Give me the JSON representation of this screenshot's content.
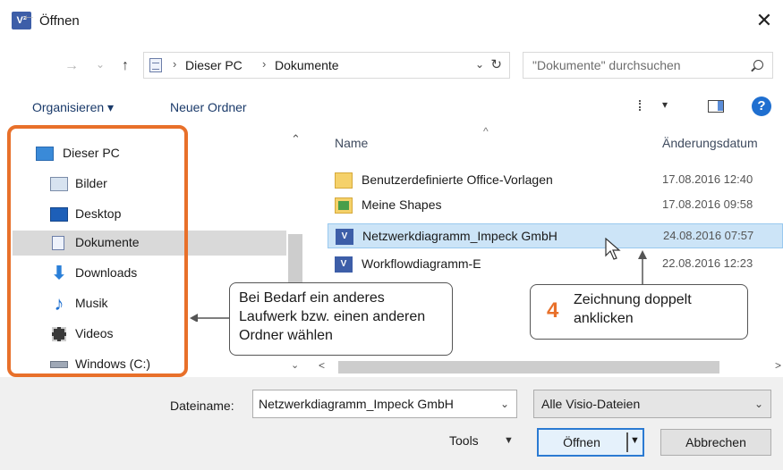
{
  "window": {
    "app_icon": "V²",
    "title": "Öffnen",
    "close": "✕"
  },
  "nav": {
    "back": "←",
    "forward": "→",
    "recent": "⌄",
    "up": "↑"
  },
  "address": {
    "crumbs": [
      "Dieser PC",
      "Dokumente"
    ],
    "separator": "›",
    "dropdown": "⌄",
    "refresh": "↻"
  },
  "search": {
    "placeholder": "\"Dokumente\" durchsuchen"
  },
  "toolbar": {
    "organize": "Organisieren ▾",
    "new_folder": "Neuer Ordner",
    "view_dropdown": "▾",
    "help": "?"
  },
  "sidebar": {
    "items": [
      {
        "label": "Dieser PC",
        "icon": "monitor-icon"
      },
      {
        "label": "Bilder",
        "icon": "pictures-icon"
      },
      {
        "label": "Desktop",
        "icon": "desktop-icon"
      },
      {
        "label": "Dokumente",
        "icon": "documents-icon"
      },
      {
        "label": "Downloads",
        "icon": "download-arrow-icon"
      },
      {
        "label": "Musik",
        "icon": "music-note-icon"
      },
      {
        "label": "Videos",
        "icon": "film-icon"
      },
      {
        "label": "Windows (C:)",
        "icon": "drive-icon"
      }
    ],
    "selected": "Dokumente"
  },
  "scrollbar": {
    "up": "⌃",
    "down": "⌄",
    "left": "<",
    "right": ">"
  },
  "filelist": {
    "headers": {
      "name": "Name",
      "date": "Änderungsdatum"
    },
    "sort_caret": "^",
    "rows": [
      {
        "name": "Benutzerdefinierte Office-Vorlagen",
        "date": "17.08.2016 12:40",
        "icon": "folder-icon"
      },
      {
        "name": "Meine Shapes",
        "date": "17.08.2016 09:58",
        "icon": "shapes-folder-icon"
      },
      {
        "name": "Netzwerkdiagramm_Impeck GmbH",
        "date": "24.08.2016 07:57",
        "icon": "visio-file-icon"
      },
      {
        "name": "Workflowdiagramm-E",
        "date": "22.08.2016 12:23",
        "icon": "visio-file-icon"
      }
    ],
    "selected": "Netzwerkdiagramm_Impeck GmbH"
  },
  "callouts": {
    "left": "Bei Bedarf ein anderes Laufwerk bzw. einen anderen Ordner wählen",
    "right_number": "4",
    "right": "Zeichnung doppelt anklicken"
  },
  "bottom": {
    "filename_label": "Dateiname:",
    "filename_value": "Netzwerkdiagramm_Impeck GmbH",
    "filename_dd": "⌄",
    "filetype": "Alle Visio-Dateien",
    "filetype_dd": "⌄",
    "tools": "Tools",
    "tools_dd": "▼",
    "open": "Öffnen",
    "open_dd": "▼",
    "cancel": "Abbrechen"
  },
  "colors": {
    "accent_orange": "#e8702a",
    "selection_blue": "#cce4f7",
    "help_blue": "#1f6fd0"
  }
}
